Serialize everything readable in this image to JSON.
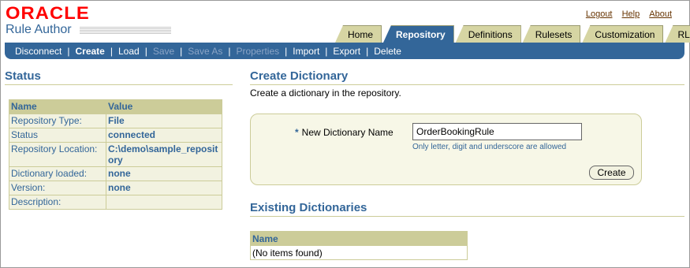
{
  "brand": {
    "logo": "ORACLE",
    "app_name": "Rule Author"
  },
  "global_links": [
    "Logout",
    "Help",
    "About"
  ],
  "tabs": [
    {
      "label": "Home",
      "active": false
    },
    {
      "label": "Repository",
      "active": true
    },
    {
      "label": "Definitions",
      "active": false
    },
    {
      "label": "Rulesets",
      "active": false
    },
    {
      "label": "Customization",
      "active": false
    },
    {
      "label": "RL",
      "active": false
    }
  ],
  "subnav": [
    {
      "label": "Disconnect",
      "state": "enabled"
    },
    {
      "label": "Create",
      "state": "selected"
    },
    {
      "label": "Load",
      "state": "enabled"
    },
    {
      "label": "Save",
      "state": "disabled"
    },
    {
      "label": "Save As",
      "state": "disabled"
    },
    {
      "label": "Properties",
      "state": "disabled"
    },
    {
      "label": "Import",
      "state": "enabled"
    },
    {
      "label": "Export",
      "state": "enabled"
    },
    {
      "label": "Delete",
      "state": "enabled"
    }
  ],
  "status": {
    "title": "Status",
    "headers": {
      "name": "Name",
      "value": "Value"
    },
    "rows": [
      {
        "name": "Repository Type:",
        "value": "File"
      },
      {
        "name": "Status",
        "value": "connected"
      },
      {
        "name": "Repository Location:",
        "value": "C:\\demo\\sample_repository"
      },
      {
        "name": "Dictionary loaded:",
        "value": "none"
      },
      {
        "name": "Version:",
        "value": "none"
      },
      {
        "name": "Description:",
        "value": ""
      }
    ]
  },
  "create_dictionary": {
    "title": "Create Dictionary",
    "description": "Create a dictionary in the repository.",
    "field_label": "New Dictionary Name",
    "required_mark": "*",
    "field_value": "OrderBookingRule",
    "hint": "Only letter, digit and underscore are allowed",
    "create_button": "Create"
  },
  "existing": {
    "title": "Existing Dictionaries",
    "header": "Name",
    "empty_text": "(No items found)"
  },
  "colors": {
    "accent": "#336699",
    "logo": "#ff0000",
    "tab_bg": "#d6d5a3",
    "table_header": "#cccc99"
  }
}
